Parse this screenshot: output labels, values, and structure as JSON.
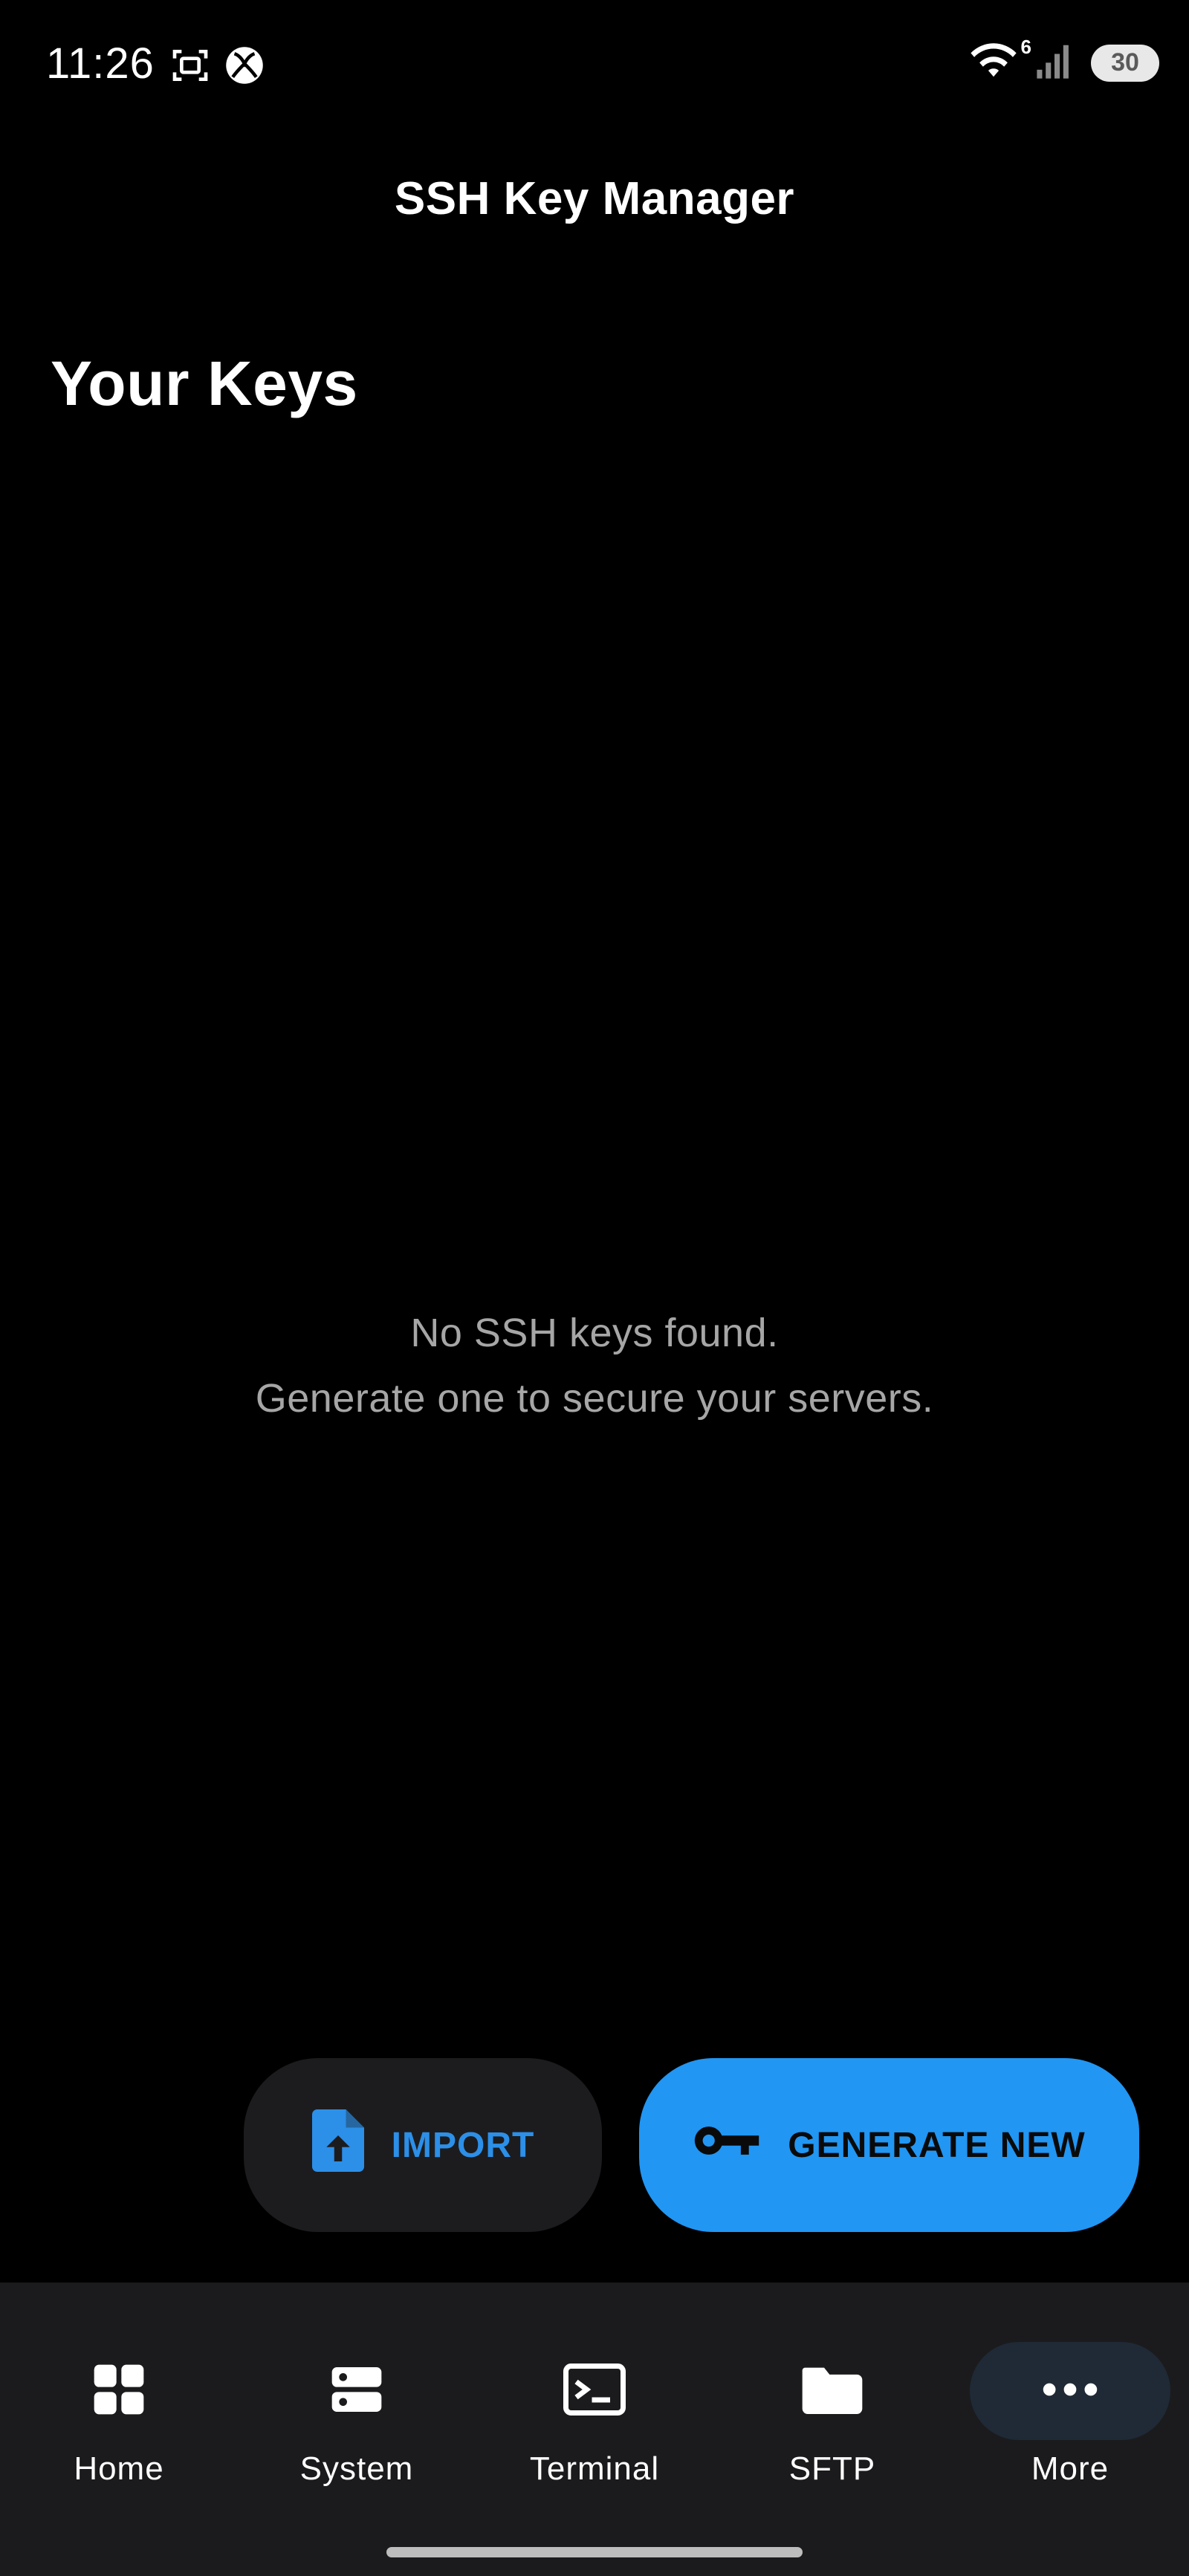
{
  "status_bar": {
    "time": "11:26",
    "wifi_label": "6",
    "battery_level": "30"
  },
  "app_bar": {
    "title": "SSH Key Manager"
  },
  "section": {
    "title": "Your Keys"
  },
  "empty_state": {
    "line1": "No SSH keys found.",
    "line2": "Generate one to secure your servers."
  },
  "actions": {
    "import_label": "IMPORT",
    "generate_label": "GENERATE NEW"
  },
  "nav": {
    "items": [
      {
        "label": "Home",
        "icon": "grid-icon"
      },
      {
        "label": "System",
        "icon": "server-icon"
      },
      {
        "label": "Terminal",
        "icon": "terminal-icon"
      },
      {
        "label": "SFTP",
        "icon": "folder-icon"
      },
      {
        "label": "More",
        "icon": "more-icon",
        "active": true
      }
    ]
  },
  "colors": {
    "background": "#000000",
    "accent": "#2196f3",
    "nav_background": "#1b1b1d",
    "secondary_text": "#a6a6a6"
  }
}
